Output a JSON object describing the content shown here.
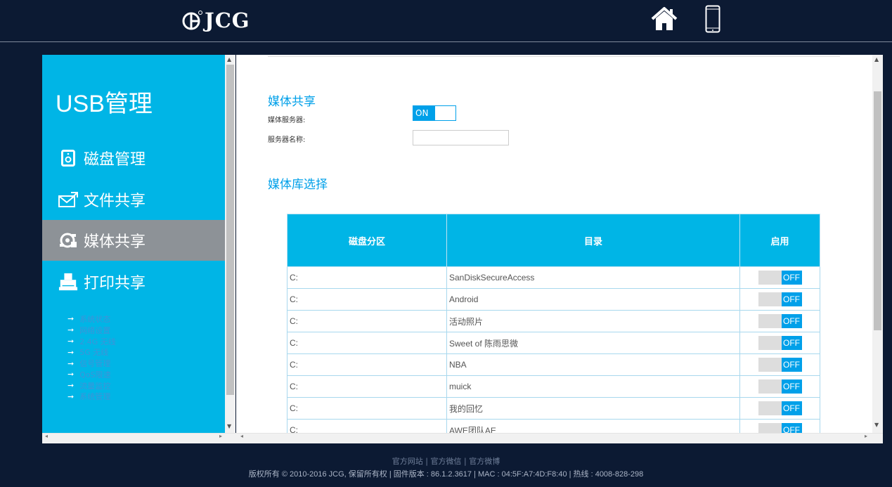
{
  "header": {
    "brand": "JCG"
  },
  "sidebar": {
    "title": "USB管理",
    "items": [
      {
        "label": "磁盘管理",
        "icon": "disk-icon"
      },
      {
        "label": "文件共享",
        "icon": "mail-icon"
      },
      {
        "label": "媒体共享",
        "icon": "media-icon",
        "active": true
      },
      {
        "label": "打印共享",
        "icon": "printer-icon"
      }
    ],
    "sublinks": [
      "系统状态",
      "网络设置",
      "2.4G 无线",
      "5G 无线",
      "信号管理",
      "QoS限速",
      "流量监控",
      "系统管理"
    ]
  },
  "main": {
    "media_share": {
      "title": "媒体共享",
      "server_label": "媒体服务器:",
      "server_toggle": "ON",
      "name_label": "服务器名称:",
      "name_value": ""
    },
    "library": {
      "title": "媒体库选择",
      "columns": [
        "磁盘分区",
        "目录",
        "启用"
      ],
      "rows": [
        {
          "partition": "C:",
          "dir": "SanDiskSecureAccess",
          "enabled": "OFF"
        },
        {
          "partition": "C:",
          "dir": "Android",
          "enabled": "OFF"
        },
        {
          "partition": "C:",
          "dir": "活动照片",
          "enabled": "OFF"
        },
        {
          "partition": "C:",
          "dir": "Sweet of 陈雨思微",
          "enabled": "OFF"
        },
        {
          "partition": "C:",
          "dir": "NBA",
          "enabled": "OFF"
        },
        {
          "partition": "C:",
          "dir": "muick",
          "enabled": "OFF"
        },
        {
          "partition": "C:",
          "dir": "我的回忆",
          "enabled": "OFF"
        },
        {
          "partition": "C:",
          "dir": "AWE团队AE",
          "enabled": "OFF"
        }
      ]
    }
  },
  "footer": {
    "links": [
      "官方网站",
      "官方微信",
      "官方微博"
    ],
    "copyright": "版权所有 © 2010-2016 JCG, 保留所有权 | 固件版本 : 86.1.2.3617 | MAC : 04:5F:A7:4D:F8:40 | 热线 : 4008-828-298"
  },
  "colors": {
    "background": "#0c1a33",
    "accent": "#00b5e6",
    "toggle": "#00a0e9",
    "active_nav": "#8d9297"
  }
}
